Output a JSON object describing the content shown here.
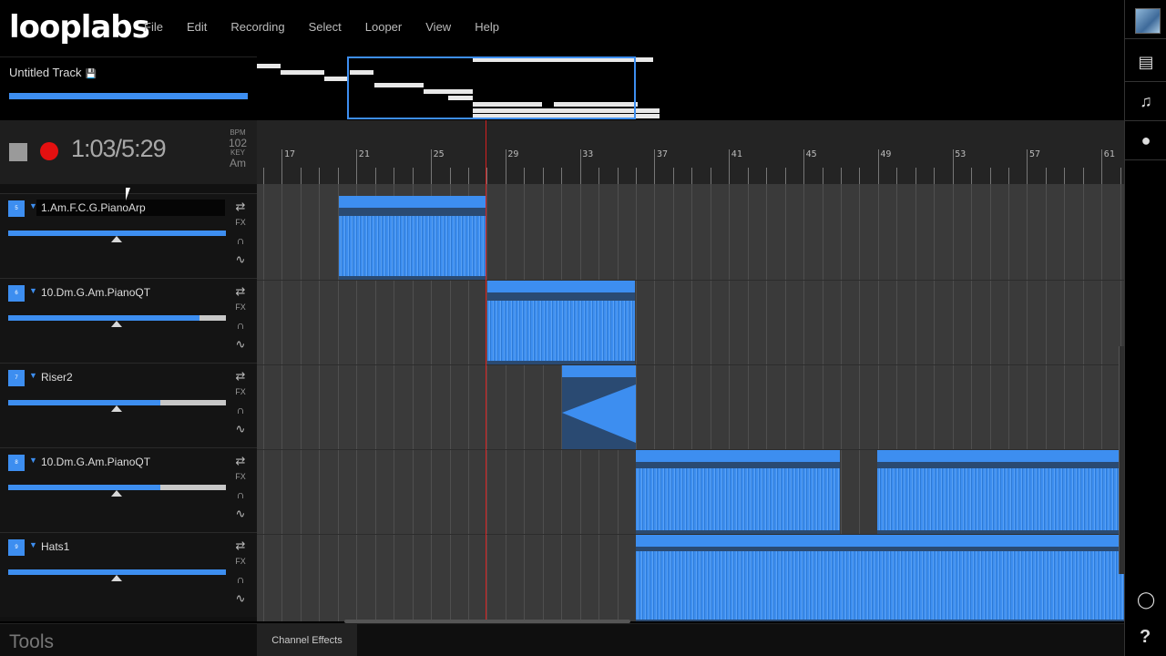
{
  "app": {
    "logo": "looplabs"
  },
  "menu": [
    "File",
    "Edit",
    "Recording",
    "Select",
    "Looper",
    "View",
    "Help"
  ],
  "track": {
    "title": "Untitled Track",
    "save_icon": "save-icon"
  },
  "transport": {
    "time": "1:03/5:29",
    "bpm_label": "BPM",
    "bpm": "102",
    "key_label": "KEY",
    "key": "Am"
  },
  "ruler": {
    "bars": [
      "17",
      "21",
      "25",
      "29",
      "33",
      "37",
      "41",
      "45",
      "49",
      "53",
      "57",
      "61"
    ]
  },
  "tracks": [
    {
      "num": "5",
      "name": "1.Am.F.C.G.PianoArp",
      "volume": 1.0,
      "fx": "FX"
    },
    {
      "num": "6",
      "name": "10.Dm.G.Am.PianoQT",
      "volume": 0.88,
      "fx": "FX"
    },
    {
      "num": "7",
      "name": "Riser2",
      "volume": 0.7,
      "fx": "FX"
    },
    {
      "num": "8",
      "name": "10.Dm.G.Am.PianoQT",
      "volume": 0.7,
      "fx": "FX"
    },
    {
      "num": "9",
      "name": "Hats1",
      "volume": 1.0,
      "fx": "FX"
    }
  ],
  "bottom": {
    "tools": "Tools",
    "channel_effects": "Channel Effects"
  },
  "sidebar": {
    "icons": [
      "avatar",
      "drive-icon",
      "music-note-icon",
      "chat-icon",
      "lightbulb-icon",
      "help-icon"
    ],
    "help": "?"
  },
  "colors": {
    "accent": "#3d8ef0",
    "record": "#e41010",
    "playhead": "#d42020"
  }
}
